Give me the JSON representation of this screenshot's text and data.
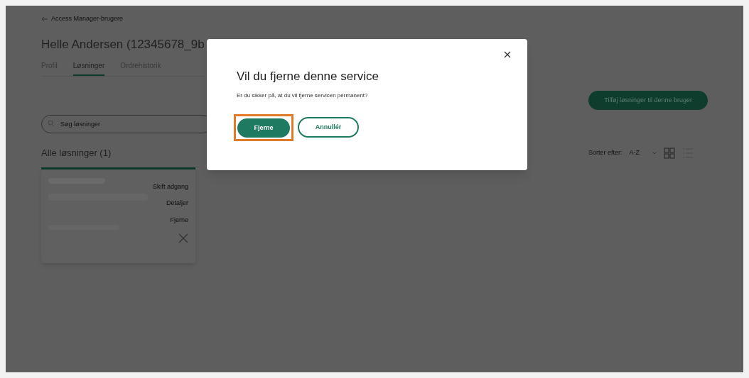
{
  "back_link": "Access Manager-brugere",
  "title": "Helle Andersen (12345678_9b",
  "tabs": [
    {
      "label": "Profil",
      "selected": false
    },
    {
      "label": "Løsninger",
      "selected": true
    },
    {
      "label": "Ordrehistorik",
      "selected": false
    }
  ],
  "add_button": "Tilføj løsninger til denne bruger",
  "search": {
    "placeholder": "Søg løsninger"
  },
  "section_title": "Alle løsninger (1)",
  "sort": {
    "label": "Sorter efter:",
    "value": "A-Z"
  },
  "card": {
    "actions": [
      "Skift adgang",
      "Detaljer",
      "Fjerne"
    ]
  },
  "dialog": {
    "title": "Vil du fjerne denne service",
    "message": "Er du sikker på, at du vil fjerne servicen permanent?",
    "confirm": "Fjerne",
    "cancel": "Annullér",
    "confirm_highlighted": true
  }
}
